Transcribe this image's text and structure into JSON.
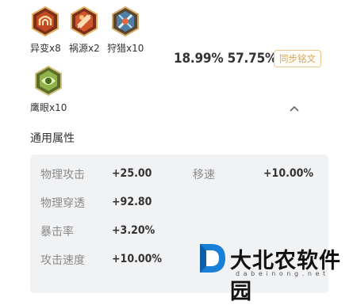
{
  "runes": [
    {
      "label": "异变x8",
      "icon": "mutation-rune-icon"
    },
    {
      "label": "祸源x2",
      "icon": "calamity-rune-icon"
    },
    {
      "label": "狩猎x10",
      "icon": "hunt-rune-icon"
    },
    {
      "label": "鹰眼x10",
      "icon": "hawkeye-rune-icon"
    }
  ],
  "summary": {
    "crit_rate": "18.99%",
    "attack_rate": "57.75%",
    "sync_button": "同步铭文"
  },
  "attributes": {
    "title": "通用属性",
    "rows": [
      {
        "name": "物理攻击",
        "value": "+25.00"
      },
      {
        "name": "移速",
        "value": "+10.00%"
      },
      {
        "name": "物理穿透",
        "value": "+92.80"
      },
      {
        "name": "暴击率",
        "value": "+3.20%"
      },
      {
        "name": "攻击速度",
        "value": "+10.00%"
      }
    ]
  },
  "watermark": {
    "title": "大北农软件园",
    "subtitle": "dabeinong.net"
  },
  "colors": {
    "accent": "#d7a55a",
    "panel_bg": "#f1f2f4"
  }
}
